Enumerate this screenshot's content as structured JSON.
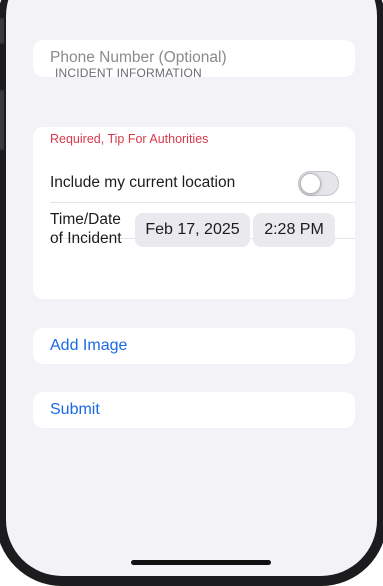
{
  "form": {
    "phone_placeholder": "Phone Number (Optional)",
    "section_header": "INCIDENT INFORMATION",
    "incident_placeholder": "Required, Tip For Authorities",
    "location_label": "Include my current location",
    "location_enabled": false,
    "time_label_line1": "Time/Date",
    "time_label_line2": "of Incident",
    "date_value": "Feb 17, 2025",
    "time_value": "2:28 PM",
    "add_image_label": "Add Image",
    "submit_label": "Submit"
  },
  "colors": {
    "background": "#f2f2f7",
    "accent": "#1a6ae6",
    "required_red": "#d93a4a"
  }
}
